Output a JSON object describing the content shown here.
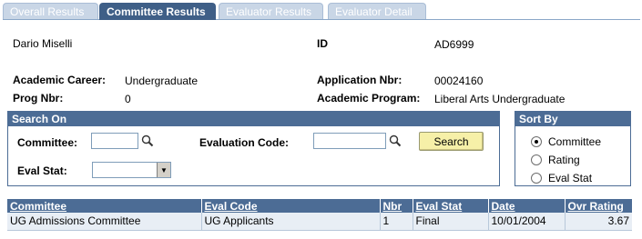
{
  "tabs": [
    {
      "label": "Overall Results",
      "active": false
    },
    {
      "label": "Committee Results",
      "active": true
    },
    {
      "label": "Evaluator Results",
      "active": false
    },
    {
      "label": "Evaluator Detail",
      "active": false
    }
  ],
  "applicant": {
    "name": "Dario Miselli",
    "id_label": "ID",
    "id_value": "AD6999",
    "career_label": "Academic Career:",
    "career_value": "Undergraduate",
    "appnbr_label": "Application Nbr:",
    "appnbr_value": "00024160",
    "prog_label": "Prog Nbr:",
    "prog_value": "0",
    "program_label": "Academic Program:",
    "program_value": "Liberal Arts Undergraduate"
  },
  "search": {
    "header": "Search On",
    "committee_label": "Committee:",
    "committee_value": "",
    "evalcode_label": "Evaluation Code:",
    "evalcode_value": "",
    "evalstat_label": "Eval Stat:",
    "evalstat_value": "",
    "button_label": "Search"
  },
  "sort": {
    "header": "Sort By",
    "options": [
      {
        "label": "Committee",
        "selected": true
      },
      {
        "label": "Rating",
        "selected": false
      },
      {
        "label": "Eval Stat",
        "selected": false
      }
    ]
  },
  "grid": {
    "columns": [
      "Committee",
      "Eval Code",
      "Nbr",
      "Eval Stat",
      "Date",
      "Ovr Rating"
    ],
    "rows": [
      {
        "committee": "UG Admissions Committee",
        "eval_code": "UG Applicants",
        "nbr": "1",
        "eval_stat": "Final",
        "date": "10/01/2004",
        "ovr_rating": "3.67"
      }
    ]
  }
}
